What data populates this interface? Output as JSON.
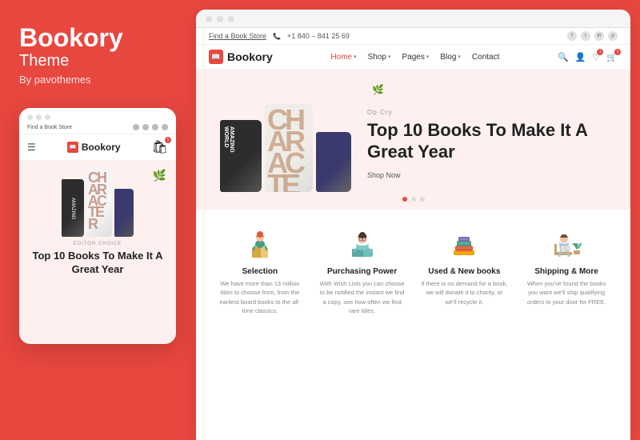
{
  "brand": {
    "title": "Bookory",
    "subtitle": "Theme",
    "by": "By pavothemes"
  },
  "mobile": {
    "find_store": "Find a Book Store",
    "logo": "Bookory",
    "hero_label": "EDITOR CHOICE",
    "hero_title": "Top 10 Books To Make It A Great Year"
  },
  "desktop": {
    "find_store": "Find a Book Store",
    "phone": "+1 840 – 841 25 69",
    "logo": "Bookory",
    "menu": [
      {
        "label": "Home",
        "active": true,
        "has_dropdown": true
      },
      {
        "label": "Shop",
        "active": false,
        "has_dropdown": true
      },
      {
        "label": "Pages",
        "active": false,
        "has_dropdown": true
      },
      {
        "label": "Blog",
        "active": false,
        "has_dropdown": true
      },
      {
        "label": "Contact",
        "active": false,
        "has_dropdown": false
      }
    ],
    "hero": {
      "tag": "Op·Cry",
      "title": "Top 10 Books To Make It A Great Year",
      "button": "Shop Now",
      "dots": 3
    },
    "features": [
      {
        "id": "selection",
        "title": "Selection",
        "desc": "We have more than 13 million titles to choose from, from the earliest board books to the all-time classics."
      },
      {
        "id": "purchasing",
        "title": "Purchasing Power",
        "desc": "With Wish Lists you can choose to be notified the instant we find a copy, see how often we find rare titles."
      },
      {
        "id": "used-new",
        "title": "Used & New books",
        "desc": "If there is no demand for a book, we will donate it to charity, or we'll recycle it."
      },
      {
        "id": "shipping",
        "title": "Shipping & More",
        "desc": "When you've found the books you want we'll ship qualifying orders to your door for FREE."
      }
    ]
  },
  "colors": {
    "primary": "#e8473f",
    "white": "#ffffff",
    "hero_bg": "#fdf0ef"
  }
}
